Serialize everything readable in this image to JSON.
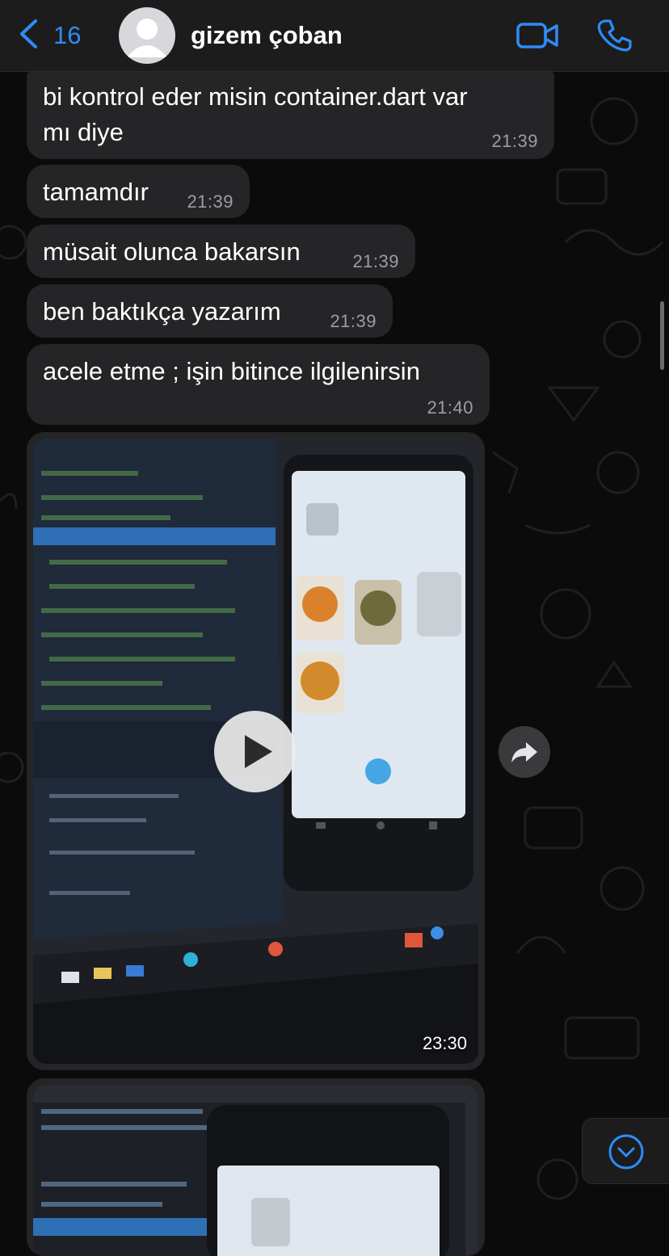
{
  "header": {
    "back_count": "16",
    "contact_name": "gizem çoban"
  },
  "messages": [
    {
      "line1": "bi kontrol eder misin container.dart var",
      "line2": "mı diye",
      "time": "21:39"
    },
    {
      "text": "tamamdır",
      "time": "21:39"
    },
    {
      "text": "müsait olunca bakarsın",
      "time": "21:39"
    },
    {
      "text": "ben baktıkça yazarım",
      "time": "21:39"
    },
    {
      "text": "acele etme ; işin bitince ilgilenirsin",
      "time": "21:40"
    }
  ],
  "video_message": {
    "time": "23:30"
  },
  "colors": {
    "accent": "#2e8cf6",
    "bubble": "#252527",
    "header": "#1c1c1d",
    "timestamp": "#9d9da3"
  },
  "icons": {
    "back": "chevron-left-icon",
    "video_call": "video-camera-icon",
    "voice_call": "phone-icon",
    "play": "play-icon",
    "forward": "forward-arrow-icon",
    "scroll_down": "chevron-down-circle-icon"
  }
}
